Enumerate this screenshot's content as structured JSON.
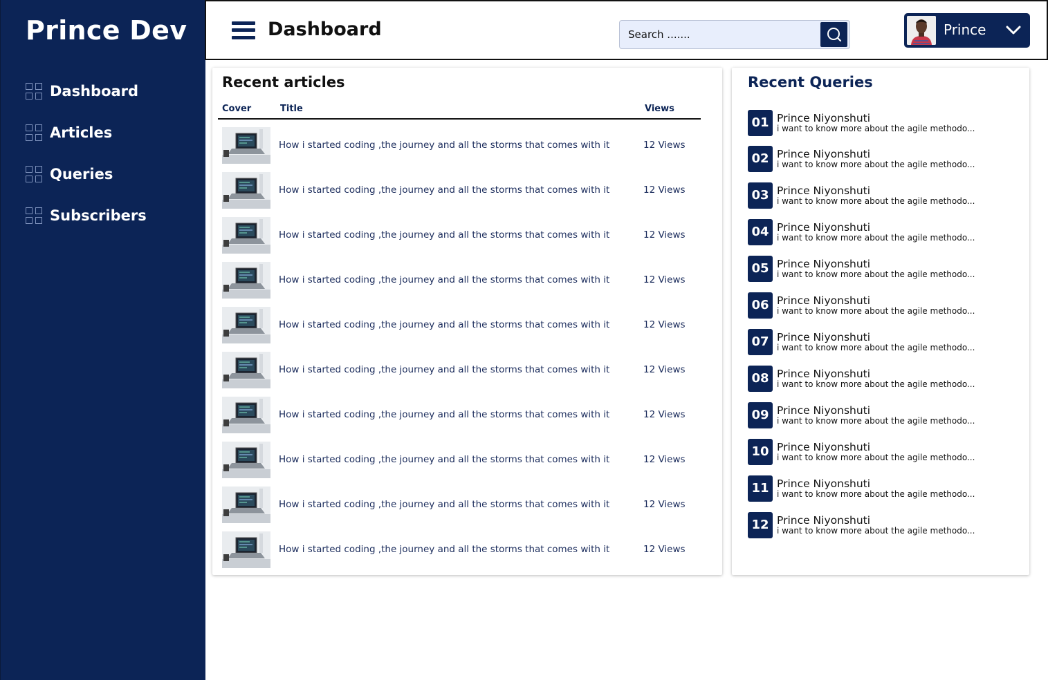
{
  "sidebar": {
    "brand": "Prince Dev",
    "items": [
      {
        "label": "Dashboard",
        "icon": "grid-icon"
      },
      {
        "label": "Articles",
        "icon": "grid-icon"
      },
      {
        "label": "Queries",
        "icon": "grid-icon"
      },
      {
        "label": "Subscribers",
        "icon": "grid-icon"
      }
    ]
  },
  "header": {
    "menu_icon": "hamburger-icon",
    "title": "Dashboard",
    "search_placeholder": "Search .......",
    "search_icon": "search-icon",
    "user_name": "Prince",
    "dropdown_icon": "chevron-down-icon"
  },
  "articles": {
    "title": "Recent articles",
    "columns": [
      "Cover",
      "Title",
      "Views"
    ],
    "rows": [
      {
        "title": "How i started coding ,the journey and all the storms that comes with it",
        "views": "12 Views"
      },
      {
        "title": "How i started coding ,the journey and all the storms that comes with it",
        "views": "12 Views"
      },
      {
        "title": "How i started coding ,the journey and all the storms that comes with it",
        "views": "12 Views"
      },
      {
        "title": "How i started coding ,the journey and all the storms that comes with it",
        "views": "12 Views"
      },
      {
        "title": "How i started coding ,the journey and all the storms that comes with it",
        "views": "12 Views"
      },
      {
        "title": "How i started coding ,the journey and all the storms that comes with it",
        "views": "12 Views"
      },
      {
        "title": "How i started coding ,the journey and all the storms that comes with it",
        "views": "12 Views"
      },
      {
        "title": "How i started coding ,the journey and all the storms that comes with it",
        "views": "12 Views"
      },
      {
        "title": "How i started coding ,the journey and all the storms that comes with it",
        "views": "12 Views"
      },
      {
        "title": "How i started coding ,the journey and all the storms that comes with it",
        "views": "12 Views"
      }
    ]
  },
  "queries": {
    "title": "Recent Queries",
    "items": [
      {
        "num": "01",
        "name": "Prince Niyonshuti",
        "message": "i want to know more about the agile methodo..."
      },
      {
        "num": "02",
        "name": "Prince Niyonshuti",
        "message": "i want to know more about the agile methodo..."
      },
      {
        "num": "03",
        "name": "Prince Niyonshuti",
        "message": "i want to know more about the agile methodo..."
      },
      {
        "num": "04",
        "name": "Prince Niyonshuti",
        "message": "i want to know more about the agile methodo..."
      },
      {
        "num": "05",
        "name": "Prince Niyonshuti",
        "message": "i want to know more about the agile methodo..."
      },
      {
        "num": "06",
        "name": "Prince Niyonshuti",
        "message": "i want to know more about the agile methodo..."
      },
      {
        "num": "07",
        "name": "Prince Niyonshuti",
        "message": "i want to know more about the agile methodo..."
      },
      {
        "num": "08",
        "name": "Prince Niyonshuti",
        "message": "i want to know more about the agile methodo..."
      },
      {
        "num": "09",
        "name": "Prince Niyonshuti",
        "message": "i want to know more about the agile methodo..."
      },
      {
        "num": "10",
        "name": "Prince Niyonshuti",
        "message": "i want to know more about the agile methodo..."
      },
      {
        "num": "11",
        "name": "Prince Niyonshuti",
        "message": "i want to know more about the agile methodo..."
      },
      {
        "num": "12",
        "name": "Prince Niyonshuti",
        "message": "i want to know more about the agile methodo..."
      }
    ]
  },
  "colors": {
    "primary": "#0c2456",
    "search_bg": "#e8eefc",
    "text_link": "#1b2c5c"
  }
}
